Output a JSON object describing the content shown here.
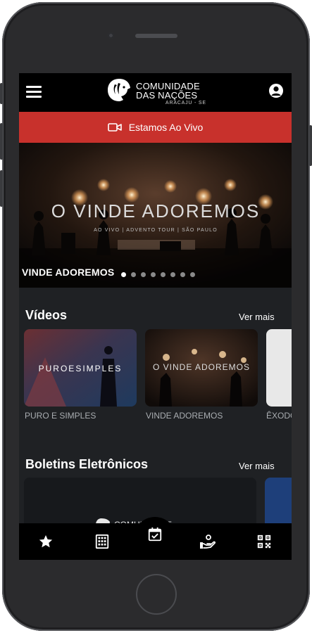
{
  "app": {
    "logo_line1": "COMUNIDADE",
    "logo_line2": "DAS NAÇÕES",
    "logo_sub": "ARACAJU - SE"
  },
  "live_banner": {
    "label": "Estamos Ao Vivo",
    "color": "#c8312c"
  },
  "hero": {
    "caption": "VINDE ADOREMOS",
    "overlay_title": "O VINDE ADOREMOS",
    "overlay_subtitle": "AO VIVO | ADVENTO TOUR | SÃO PAULO",
    "slide_count": 8,
    "active_slide": 0
  },
  "videos": {
    "title": "Vídeos",
    "see_more": "Ver mais",
    "items": [
      {
        "label": "PURO E SIMPLES",
        "thumb_text": "PUROESIMPLES"
      },
      {
        "label": "VINDE ADOREMOS",
        "thumb_text": "O VINDE ADOREMOS"
      },
      {
        "label": "ÊXODO",
        "thumb_text": ""
      }
    ]
  },
  "bulletins": {
    "title": "Boletins Eletrônicos",
    "see_more": "Ver mais",
    "logo_text": "COMUNIDADE"
  },
  "tabbar": {
    "items": [
      "star-icon",
      "building-icon",
      "calendar-check-icon",
      "hand-icon",
      "qr-code-icon"
    ]
  },
  "colors": {
    "background": "#1f2124",
    "topbar": "#000000",
    "text": "#ffffff",
    "muted": "#a9adb1"
  }
}
